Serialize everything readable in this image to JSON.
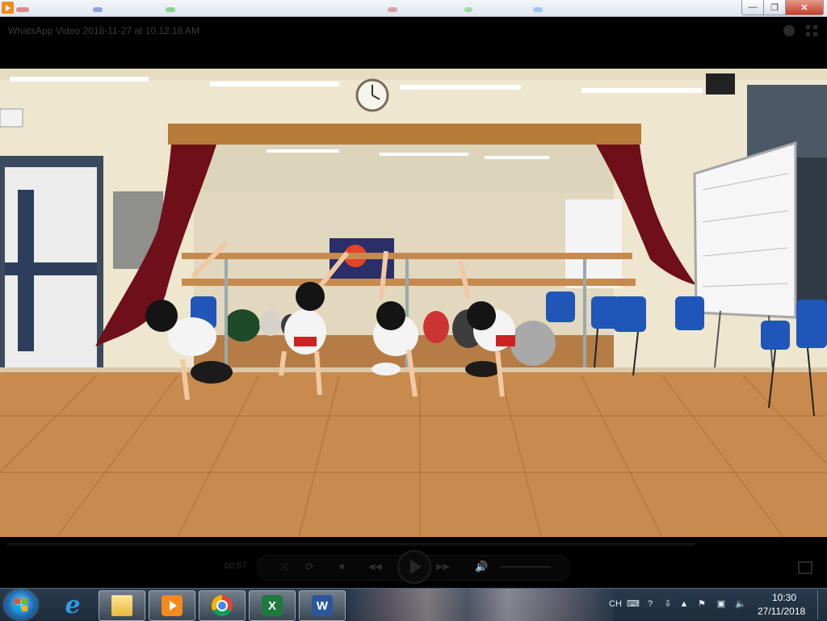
{
  "window": {
    "title": "WhatsApp Video 2018-11-27 at 10.12.18 AM",
    "buttons": {
      "minimize": "—",
      "maximize": "❐",
      "close": "✕"
    }
  },
  "player": {
    "elapsed_time": "00:57",
    "progress_fraction": 0.0,
    "controls": {
      "shuffle": "⤨",
      "repeat": "⟳",
      "stop": "■",
      "previous": "◀◀",
      "next": "▶▶",
      "volume": "🔊"
    }
  },
  "taskbar": {
    "apps": [
      "Internet Explorer",
      "Windows Explorer",
      "Windows Media Player",
      "Google Chrome",
      "Microsoft Excel",
      "Microsoft Word"
    ],
    "excel_letter": "X",
    "word_letter": "W",
    "tray": {
      "language": "CH",
      "time": "10:30",
      "date": "27/11/2018"
    }
  },
  "colors": {
    "taskbar": "#2a3b4e",
    "floor": "#c98a4e",
    "wall": "#efe6cf",
    "curtain": "#6e0f1a",
    "chair": "#1f56b8"
  }
}
